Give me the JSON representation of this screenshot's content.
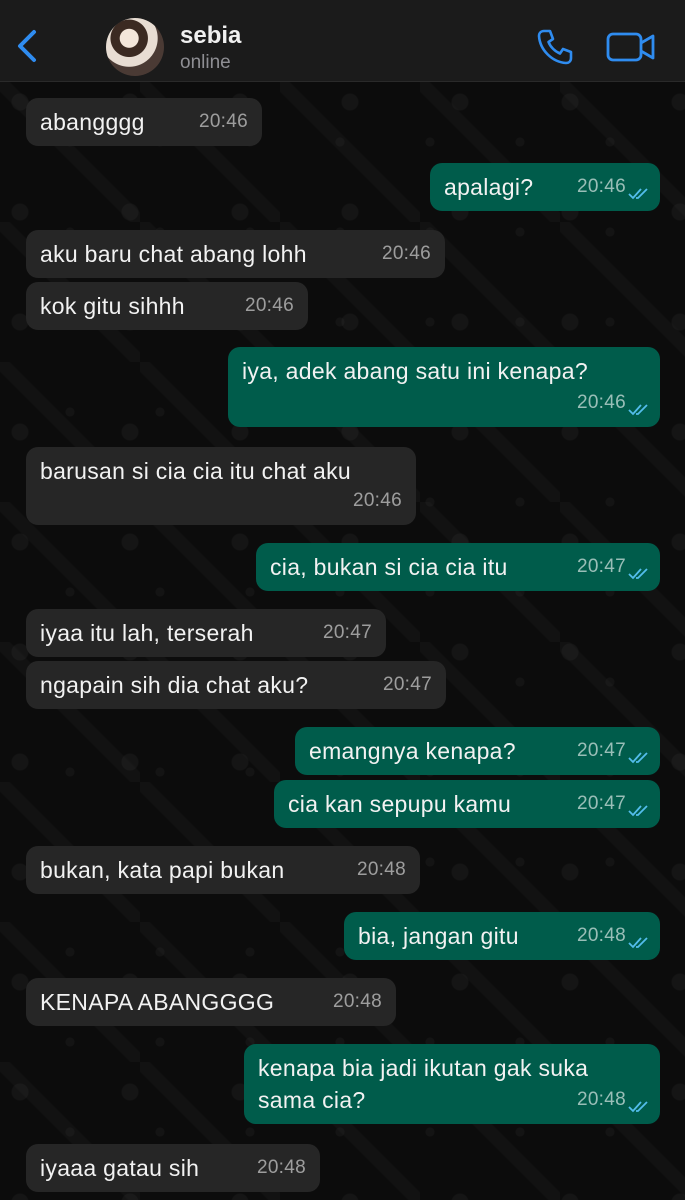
{
  "header": {
    "back_icon": "chevron-left-icon",
    "contact_name": "sebia",
    "status": "online",
    "call_icon": "phone-icon",
    "video_icon": "video-camera-icon"
  },
  "colors": {
    "accent": "#2f8cf0",
    "incoming_bubble": "#262626",
    "outgoing_bubble": "#005c4b",
    "read_ticks": "#53bdeb"
  },
  "messages": [
    {
      "dir": "in",
      "text": "abangggg",
      "time": "20:46"
    },
    {
      "dir": "out",
      "text": "apalagi?",
      "time": "20:46"
    },
    {
      "dir": "in",
      "text": "aku baru chat abang lohh",
      "time": "20:46"
    },
    {
      "dir": "in",
      "text": "kok gitu sihhh",
      "time": "20:46"
    },
    {
      "dir": "out",
      "text": "iya, adek abang satu ini kenapa?",
      "time": "20:46"
    },
    {
      "dir": "in",
      "text": "barusan si cia cia itu chat aku",
      "time": "20:46"
    },
    {
      "dir": "out",
      "text": "cia, bukan si cia cia itu",
      "time": "20:47"
    },
    {
      "dir": "in",
      "text": "iyaa itu lah, terserah",
      "time": "20:47"
    },
    {
      "dir": "in",
      "text": "ngapain sih dia chat aku?",
      "time": "20:47"
    },
    {
      "dir": "out",
      "text": "emangnya kenapa?",
      "time": "20:47"
    },
    {
      "dir": "out",
      "text": "cia kan sepupu kamu",
      "time": "20:47"
    },
    {
      "dir": "in",
      "text": "bukan, kata papi bukan",
      "time": "20:48"
    },
    {
      "dir": "out",
      "text": "bia, jangan gitu",
      "time": "20:48"
    },
    {
      "dir": "in",
      "text": "KENAPA ABANGGGG",
      "time": "20:48"
    },
    {
      "dir": "out",
      "text": "kenapa bia jadi ikutan gak suka\nsama cia?",
      "time": "20:48"
    },
    {
      "dir": "in",
      "text": "iyaaa gatau sih",
      "time": "20:48"
    }
  ]
}
